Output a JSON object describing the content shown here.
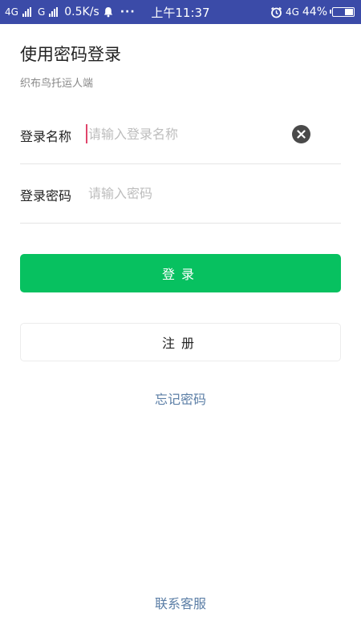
{
  "status_bar": {
    "net1": "4G",
    "net2": "G",
    "speed": "0.5K/s",
    "dots": "···",
    "time": "上午11:37",
    "net3": "4G",
    "battery": "44%",
    "battery_level": 0.44,
    "background_color": "#3b4ba8",
    "icons": [
      "signal-icon",
      "bell-icon",
      "alarm-icon",
      "battery-icon"
    ]
  },
  "page": {
    "title": "使用密码登录",
    "subtitle": "织布鸟托运人端"
  },
  "form": {
    "username": {
      "label": "登录名称",
      "placeholder": "请输入登录名称",
      "value": ""
    },
    "password": {
      "label": "登录密码",
      "placeholder": "请输入密码",
      "value": ""
    }
  },
  "actions": {
    "login_label": "登录",
    "register_label": "注册",
    "forgot_label": "忘记密码",
    "contact_label": "联系客服",
    "primary_color": "#07c160",
    "link_color": "#5b7ea6"
  }
}
